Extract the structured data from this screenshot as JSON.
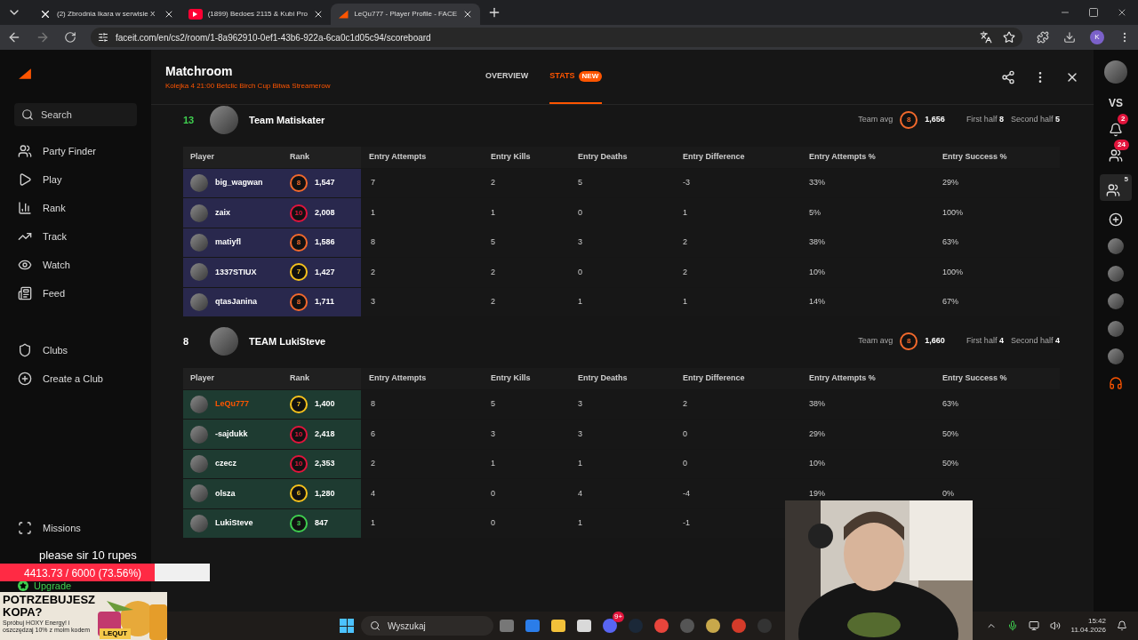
{
  "browser": {
    "tabs": [
      {
        "title": "(2) Zbrodnia Ikara w serwisie X",
        "kind": "x",
        "selected": false
      },
      {
        "title": "(1899) Bedoes 2115 & Kubi Pro",
        "kind": "video",
        "selected": false
      },
      {
        "title": "LeQu777 - Player Profile - FACE",
        "kind": "faceit",
        "selected": true
      }
    ],
    "url": "faceit.com/en/cs2/room/1-8a962910-0ef1-43b6-922a-6ca0c1d05c94/scoreboard",
    "profile_initial": "K"
  },
  "sidebar": {
    "search": {
      "placeholder": "Search"
    },
    "items": [
      {
        "label": "Party Finder",
        "kind": "party"
      },
      {
        "label": "Play",
        "kind": "play"
      },
      {
        "label": "Rank",
        "kind": "rank"
      },
      {
        "label": "Track",
        "kind": "track"
      },
      {
        "label": "Watch",
        "kind": "watch"
      },
      {
        "label": "Feed",
        "kind": "feed"
      }
    ],
    "club_items": [
      {
        "label": "Clubs",
        "kind": "clubs"
      },
      {
        "label": "Create a Club",
        "kind": "create"
      }
    ],
    "missions": "Missions",
    "upgrade": "Upgrade"
  },
  "matchroom": {
    "title": "Matchroom",
    "subtitle": "Kolejka 4 21:00 Betclic Birch Cup Bitwa Streamerow",
    "tabs": [
      {
        "label": "OVERVIEW",
        "selected": false
      },
      {
        "label": "STATS",
        "badge": "NEW",
        "selected": true
      }
    ],
    "teams": [
      {
        "columns": [
          "Player",
          "Rank",
          "Entry Attempts",
          "Entry Kills",
          "Entry Deaths",
          "Entry Difference",
          "Entry Attempts %",
          "Entry Success %"
        ],
        "score": "13",
        "won": true,
        "name": "Team Matiskater",
        "color": "#29284d",
        "avg_label": "Team avg",
        "avg_rank": {
          "level": "8",
          "color": "#f2692c"
        },
        "avg_elo": "1,656",
        "first_half_label": "First half",
        "first_half": "8",
        "second_half_label": "Second half",
        "second_half": "5",
        "players": [
          {
            "name": "big_wagwan",
            "self": false,
            "level": "8",
            "color": "#f2692c",
            "elo": "1,547",
            "cells": [
              "7",
              "2",
              "5",
              "-3",
              "33%",
              "29%"
            ]
          },
          {
            "name": "zaix",
            "self": false,
            "level": "10",
            "color": "#e2143c",
            "elo": "2,008",
            "cells": [
              "1",
              "1",
              "0",
              "1",
              "5%",
              "100%"
            ]
          },
          {
            "name": "matiyfl",
            "self": false,
            "level": "8",
            "color": "#f2692c",
            "elo": "1,586",
            "cells": [
              "8",
              "5",
              "3",
              "2",
              "38%",
              "63%"
            ]
          },
          {
            "name": "1337STIUX",
            "self": false,
            "level": "7",
            "color": "#f7c21c",
            "elo": "1,427",
            "cells": [
              "2",
              "2",
              "0",
              "2",
              "10%",
              "100%"
            ]
          },
          {
            "name": "qtasJanina",
            "self": false,
            "level": "8",
            "color": "#f2692c",
            "elo": "1,711",
            "cells": [
              "3",
              "2",
              "1",
              "1",
              "14%",
              "67%"
            ]
          }
        ]
      },
      {
        "columns": [
          "Player",
          "Rank",
          "Entry Attempts",
          "Entry Kills",
          "Entry Deaths",
          "Entry Difference",
          "Entry Attempts %",
          "Entry Success %"
        ],
        "score": "8",
        "won": false,
        "name": "TEAM LukiSteve",
        "color": "#1e3b31",
        "avg_label": "Team avg",
        "avg_rank": {
          "level": "8",
          "color": "#f2692c"
        },
        "avg_elo": "1,660",
        "first_half_label": "First half",
        "first_half": "4",
        "second_half_label": "Second half",
        "second_half": "4",
        "players": [
          {
            "name": "LeQu777",
            "self": true,
            "level": "7",
            "color": "#f7c21c",
            "elo": "1,400",
            "cells": [
              "8",
              "5",
              "3",
              "2",
              "38%",
              "63%"
            ]
          },
          {
            "name": "-sajdukk",
            "self": false,
            "level": "10",
            "color": "#e2143c",
            "elo": "2,418",
            "cells": [
              "6",
              "3",
              "3",
              "0",
              "29%",
              "50%"
            ]
          },
          {
            "name": "czecz",
            "self": false,
            "level": "10",
            "color": "#e2143c",
            "elo": "2,353",
            "cells": [
              "2",
              "1",
              "1",
              "0",
              "10%",
              "50%"
            ]
          },
          {
            "name": "olsza",
            "self": false,
            "level": "6",
            "color": "#f7c21c",
            "elo": "1,280",
            "cells": [
              "4",
              "0",
              "4",
              "-4",
              "19%",
              "0%"
            ]
          },
          {
            "name": "LukiSteve",
            "self": false,
            "level": "3",
            "color": "#3fcf4f",
            "elo": "847",
            "cells": [
              "1",
              "0",
              "1",
              "-1"
            ]
          }
        ]
      }
    ]
  },
  "right_bar": {
    "vs": "VS",
    "notifications": "2",
    "friends": "24",
    "party": "5"
  },
  "overlay": {
    "message": "please sir 10 rupes",
    "goal": "4413.73 / 6000 (73.56%)",
    "level": 0.7356,
    "ad": {
      "headline": "POTRZEBUJESZ KOPA?",
      "fine_print": "Spróbuj HOXY Energy! i oszczędzaj 10% z moim kodem",
      "code": "LEQUT"
    }
  },
  "taskbar": {
    "search_placeholder": "Wyszukaj",
    "discord_badge": "9+",
    "time": "15:42",
    "date": "11.04.2026"
  }
}
